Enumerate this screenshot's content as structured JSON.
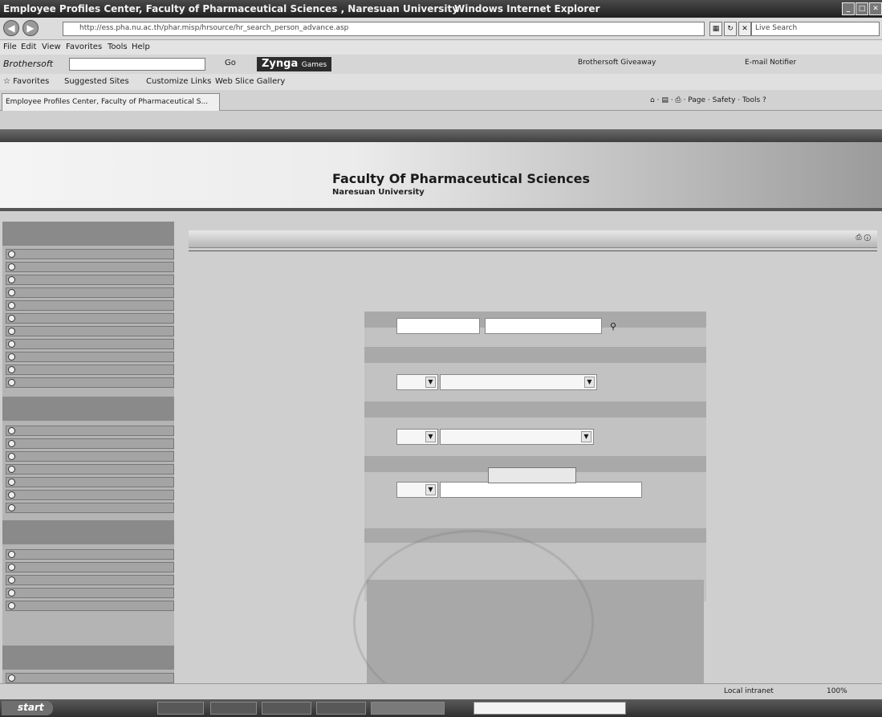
{
  "window": {
    "title": "Employee Profiles Center, Faculty of Pharmaceutical Sciences , Naresuan University",
    "app": "Windows Internet Explorer"
  },
  "address": {
    "url": "http://ess.pha.nu.ac.th/phar.misp/hrsource/hr_search_person_advance.asp"
  },
  "search": {
    "live_label": "Live Search"
  },
  "menu": {
    "items": [
      "File",
      "Edit",
      "View",
      "Favorites",
      "Tools",
      "Help"
    ]
  },
  "toolbar": {
    "brothersoft": "Brothersoft",
    "go": "Go",
    "zynga": "Zynga",
    "games": "Games",
    "giveaway": "Brothersoft Giveaway",
    "email": "E-mail Notifier"
  },
  "favorites": {
    "label": "Favorites",
    "suggested": "Suggested Sites",
    "customize": "Customize Links",
    "gallery": "Web Slice Gallery"
  },
  "tab": {
    "label": "Employee Profiles Center, Faculty of Pharmaceutical S..."
  },
  "commandbar": {
    "page": "Page",
    "safety": "Safety",
    "tools": "Tools"
  },
  "banner": {
    "title": "Faculty Of Pharmaceutical Sciences",
    "subtitle": "Naresuan University"
  },
  "content": {
    "header": ""
  },
  "form": {
    "heading": "",
    "search_button": ""
  },
  "status": {
    "zone": "Local intranet",
    "zoom": "100%"
  },
  "taskbar": {
    "start": "start"
  }
}
